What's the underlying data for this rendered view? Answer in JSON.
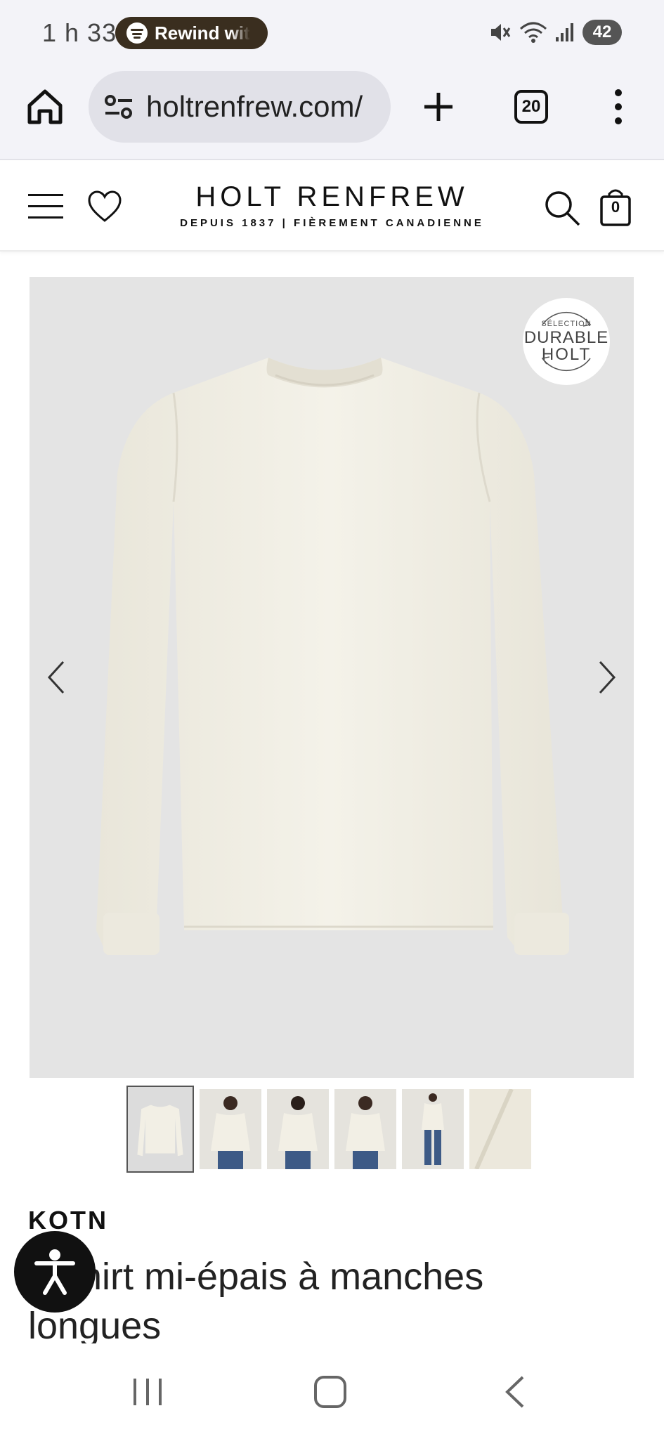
{
  "status_bar": {
    "time": "1 h 33",
    "media_label": "Rewind wit",
    "battery": "42",
    "icons": [
      "spotify-icon",
      "mute-icon",
      "wifi-icon",
      "signal-icon",
      "battery-icon"
    ]
  },
  "browser": {
    "url": "holtrenfrew.com/",
    "tab_count": "20",
    "icons": [
      "home-icon",
      "site-settings-icon",
      "new-tab-icon",
      "tabs-icon",
      "more-icon"
    ]
  },
  "site_header": {
    "logo": "HOLT RENFREW",
    "tagline": "DEPUIS 1837 | FIÈREMENT CANADIENNE",
    "bag_count": "0",
    "icons": [
      "menu-icon",
      "heart-icon",
      "search-icon",
      "shopping-bag-icon"
    ]
  },
  "product": {
    "badge": {
      "line1": "SÉLECTION",
      "line2": "DURABLE",
      "line3": "HOLT"
    },
    "thumbnail_count": 6,
    "active_thumbnail": 1,
    "brand": "KOTN",
    "title": "T-shirt mi-épais à manches longues"
  },
  "colors": {
    "status_bg": "#f3f3f8",
    "url_bg": "#e1e1e8",
    "media_pill": "#3a2e1f",
    "image_bg": "#e4e4e4",
    "shirt": "#f1eee3"
  }
}
